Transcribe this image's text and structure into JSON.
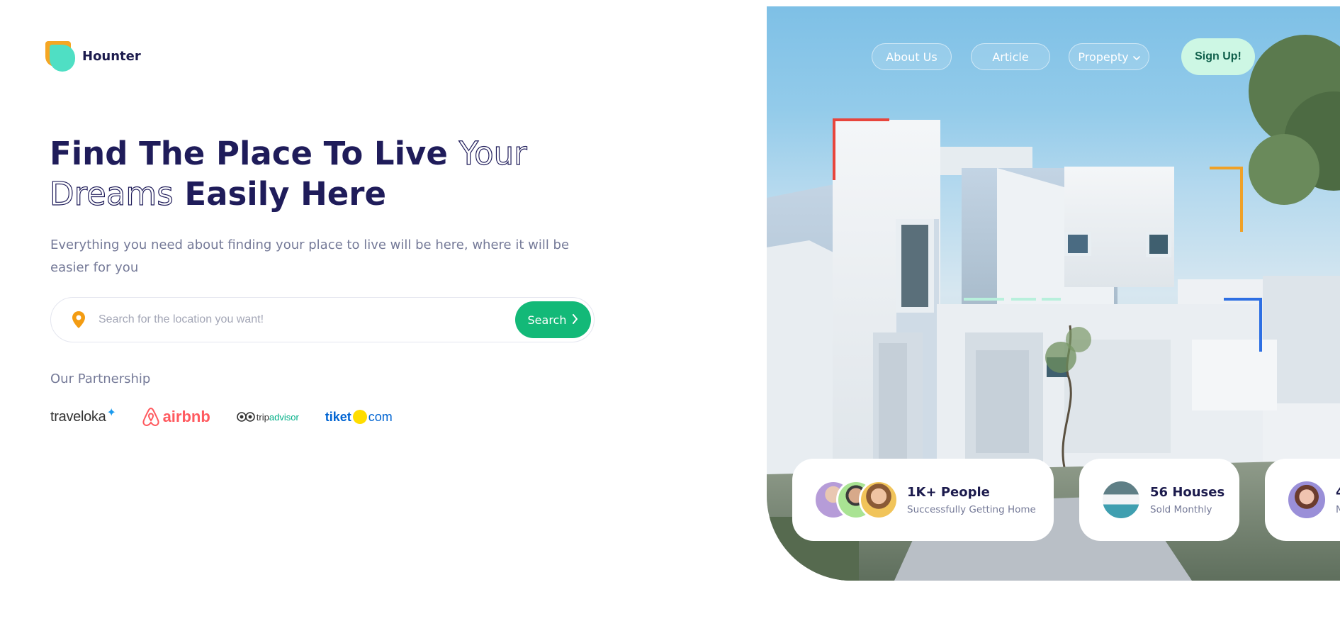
{
  "brand": {
    "name": "Hounter"
  },
  "hero": {
    "title_part1": "Find The Place To Live ",
    "title_outline1": "Your",
    "title_outline2": "Dreams",
    "title_part2": " Easily Here",
    "subtitle": "Everything you need about finding your place to live will be here, where it will be easier for you"
  },
  "search": {
    "placeholder": "Search for the location you want!",
    "button_label": "Search"
  },
  "partnership": {
    "title": "Our Partnership",
    "partners": {
      "traveloka": "traveloka",
      "airbnb": "airbnb",
      "tripadvisor_a": "trip",
      "tripadvisor_b": "advisor",
      "tiket_a": "tiket",
      "tiket_b": "com"
    }
  },
  "nav": {
    "about": "About Us",
    "article": "Article",
    "property": "Propepty",
    "signup": "Sign Up!"
  },
  "stats": [
    {
      "title": "1K+ People",
      "subtitle": "Successfully Getting Home"
    },
    {
      "title": "56 Houses",
      "subtitle": "Sold Monthly"
    },
    {
      "title": "4",
      "subtitle": "N"
    }
  ],
  "colors": {
    "brand_dark": "#1c1b4d",
    "accent_green": "#13b978",
    "signup_bg": "#cdf7e4",
    "logo_orange": "#f5a623",
    "logo_teal": "#4fdfc4",
    "pin_orange": "#f39c12"
  }
}
